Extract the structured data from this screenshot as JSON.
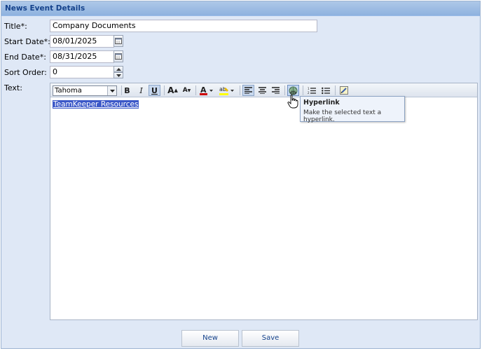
{
  "panel": {
    "title": "News Event Details"
  },
  "form": {
    "title_label": "Title*:",
    "title_value": "Company Documents",
    "start_label": "Start Date*:",
    "start_value": "08/01/2025",
    "end_label": "End Date*:",
    "end_value": "08/31/2025",
    "sort_label": "Sort Order:",
    "sort_value": "0",
    "text_label": "Text:"
  },
  "editor": {
    "font_name": "Tahoma",
    "toolbar": {
      "bold": "B",
      "italic": "I",
      "underline": "U",
      "grow": "A",
      "shrink": "A"
    },
    "content_text": "TeamKeeper Resources",
    "tooltip": {
      "title": "Hyperlink",
      "body": "Make the selected text a hyperlink."
    }
  },
  "buttons": {
    "new_label": "New",
    "save_label": "Save"
  },
  "colors": {
    "header_text": "#15428b",
    "panel_bg": "#dfe8f6",
    "selection_bg": "#3c58c8",
    "font_color_bar": "#cc0000",
    "highlight_bar": "#ffff00"
  },
  "icons": [
    "calendar-icon",
    "spinner-up-icon",
    "spinner-down-icon",
    "chevron-down-icon",
    "font-color-icon",
    "highlight-icon",
    "align-left-icon",
    "align-center-icon",
    "align-right-icon",
    "hyperlink-icon",
    "ordered-list-icon",
    "unordered-list-icon",
    "source-edit-icon",
    "hand-cursor-icon"
  ]
}
